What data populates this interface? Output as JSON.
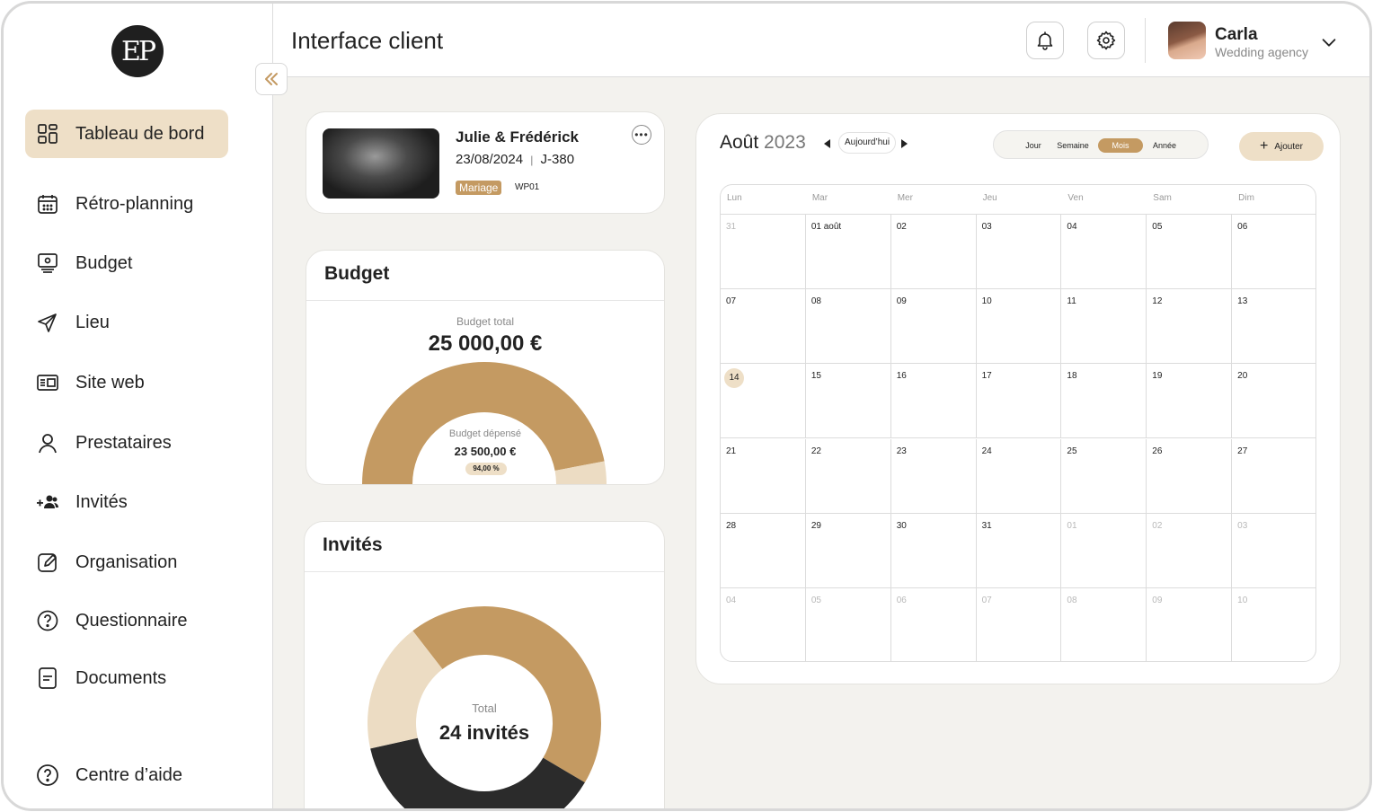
{
  "app": {
    "logo_text": "EP",
    "page_title": "Interface client"
  },
  "sidebar": {
    "items": [
      {
        "label": "Tableau de bord",
        "icon": "dashboard-icon",
        "active": true
      },
      {
        "label": "Rétro-planning",
        "icon": "calendar-icon"
      },
      {
        "label": "Budget",
        "icon": "monitor-icon"
      },
      {
        "label": "Lieu",
        "icon": "paper-plane-icon"
      },
      {
        "label": "Site web",
        "icon": "website-icon"
      },
      {
        "label": "Prestataires",
        "icon": "user-icon"
      },
      {
        "label": "Invités",
        "icon": "add-users-icon"
      },
      {
        "label": "Organisation",
        "icon": "edit-icon"
      },
      {
        "label": "Questionnaire",
        "icon": "question-circle-icon"
      },
      {
        "label": "Documents",
        "icon": "document-icon"
      }
    ],
    "help": {
      "label": "Centre d’aide",
      "icon": "help-icon"
    }
  },
  "user": {
    "name": "Carla",
    "role": "Wedding agency"
  },
  "event": {
    "couple": "Julie & Frédérick",
    "date": "23/08/2024",
    "countdown": "J-380",
    "type_tag": "Mariage",
    "code": "WP01"
  },
  "budget": {
    "title": "Budget",
    "total_label": "Budget total",
    "total_value": "25 000,00 €",
    "spent_label": "Budget dépensé",
    "spent_value": "23 500,00 €",
    "spent_percent_label": "94,00 %",
    "spent_fraction": 0.94,
    "colors": {
      "spent": "#c49a62",
      "remaining": "#ecdcc3"
    }
  },
  "guests": {
    "title": "Invités",
    "total_label": "Total",
    "total_value": "24 invités",
    "segments": [
      {
        "fraction": 0.44,
        "color": "#c49a62"
      },
      {
        "fraction": 0.38,
        "color": "#2b2b2b"
      },
      {
        "fraction": 0.18,
        "color": "#ecdcc3"
      }
    ]
  },
  "calendar": {
    "month": "Août",
    "year": "2023",
    "today_label": "Aujourd’hui",
    "views": [
      "Jour",
      "Semaine",
      "Mois",
      "Année"
    ],
    "active_view": "Mois",
    "add_label": "Ajouter",
    "weekdays": [
      "Lun",
      "Mar",
      "Mer",
      "Jeu",
      "Ven",
      "Sam",
      "Dim"
    ],
    "weeks": [
      [
        "31",
        "01 août",
        "02",
        "03",
        "04",
        "05",
        "06"
      ],
      [
        "07",
        "08",
        "09",
        "10",
        "11",
        "12",
        "13"
      ],
      [
        "14",
        "15",
        "16",
        "17",
        "18",
        "19",
        "20"
      ],
      [
        "21",
        "22",
        "23",
        "24",
        "25",
        "26",
        "27"
      ],
      [
        "28",
        "29",
        "30",
        "31",
        "01",
        "02",
        "03"
      ],
      [
        "04",
        "05",
        "06",
        "07",
        "08",
        "09",
        "10"
      ]
    ],
    "today": "14",
    "accent": "#c49a62",
    "accent_light": "#eedfc7"
  }
}
